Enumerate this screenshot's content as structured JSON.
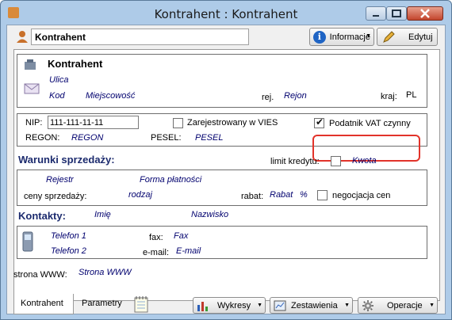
{
  "window": {
    "title": "Kontrahent : Kontrahent"
  },
  "toolbar": {
    "name_value": "Kontrahent",
    "info_label": "Informacje",
    "edit_label": "Edytuj"
  },
  "address": {
    "heading": "Kontrahent",
    "street": "Ulica",
    "postal_code": "Kod",
    "city": "Miejscowość",
    "region_label": "rej.",
    "region_value": "Rejon",
    "country_label": "kraj:",
    "country_value": "PL"
  },
  "ids": {
    "nip_label": "NIP:",
    "nip_value": "111-111-11-11",
    "vies_label": "Zarejestrowany w VIES",
    "vies_checked": false,
    "vat_label": "Podatnik VAT czynny",
    "vat_checked": true,
    "regon_label": "REGON:",
    "regon_value": "REGON",
    "pesel_label": "PESEL:",
    "pesel_value": "PESEL"
  },
  "sales": {
    "heading": "Warunki sprzedaży:",
    "credit_label": "limit kredytu:",
    "credit_value": "Kwota",
    "register": "Rejestr",
    "payment": "Forma płatności",
    "prices_label": "ceny sprzedaży:",
    "prices_value": "rodzaj",
    "discount_label": "rabat:",
    "discount_value": "Rabat",
    "percent": "%",
    "negotiation_label": "negocjacja cen"
  },
  "contacts": {
    "heading": "Kontakty:",
    "first_name": "Imię",
    "last_name": "Nazwisko",
    "phone1": "Telefon 1",
    "phone2": "Telefon 2",
    "fax_label": "fax:",
    "fax_value": "Fax",
    "email_label": "e-mail:",
    "email_value": "E-mail"
  },
  "www": {
    "label": "strona WWW:",
    "value": "Strona WWW"
  },
  "tabs": [
    "Kontrahent",
    "Parametry"
  ],
  "bottom_buttons": {
    "charts": "Wykresy",
    "reports": "Zestawienia",
    "operations": "Operacje"
  },
  "colors": {
    "highlight": "#e2332a",
    "heading": "#1c2b6e",
    "italic_value": "#00006e"
  }
}
